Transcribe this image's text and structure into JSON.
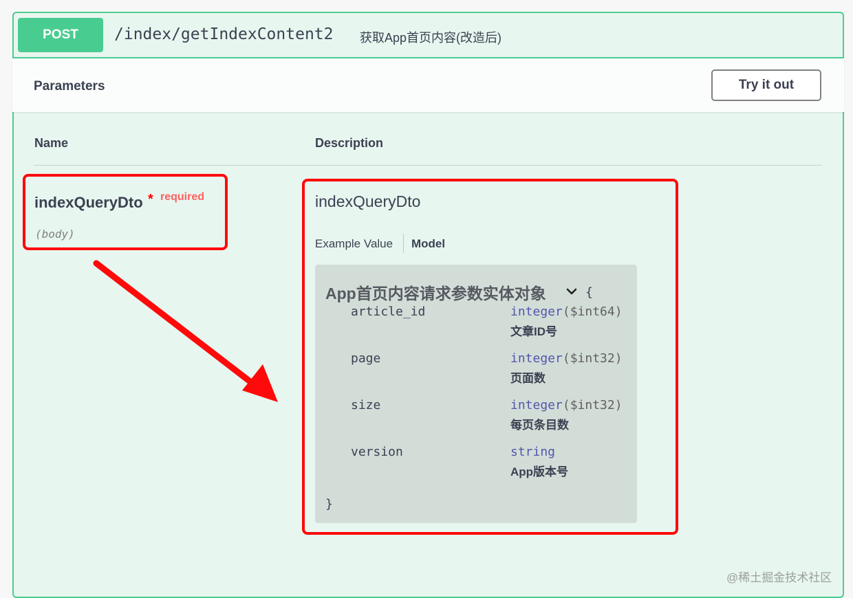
{
  "operation": {
    "method": "POST",
    "path": "/index/getIndexContent2",
    "summary": "获取App首页内容(改造后)"
  },
  "parameters": {
    "title": "Parameters",
    "try_button": "Try it out",
    "columns": {
      "name": "Name",
      "description": "Description"
    },
    "param": {
      "name": "indexQueryDto",
      "star": "*",
      "required": "required",
      "in": "(body)"
    }
  },
  "schema": {
    "name": "indexQueryDto",
    "tabs": {
      "example": "Example Value",
      "model": "Model"
    },
    "model_title": "App首页内容请求参数实体对象",
    "open_brace": "{",
    "close_brace": "}",
    "properties": [
      {
        "name": "article_id",
        "type": "integer",
        "format": "($int64)",
        "description": "文章ID号"
      },
      {
        "name": "page",
        "type": "integer",
        "format": "($int32)",
        "description": "页面数"
      },
      {
        "name": "size",
        "type": "integer",
        "format": "($int32)",
        "description": "每页条目数"
      },
      {
        "name": "version",
        "type": "string",
        "format": "",
        "description": "App版本号"
      }
    ]
  },
  "watermark": "@稀土掘金技术社区",
  "colors": {
    "post_green": "#49cc90",
    "highlight_red": "#ff0a0a",
    "type_blue": "#5555aa"
  }
}
